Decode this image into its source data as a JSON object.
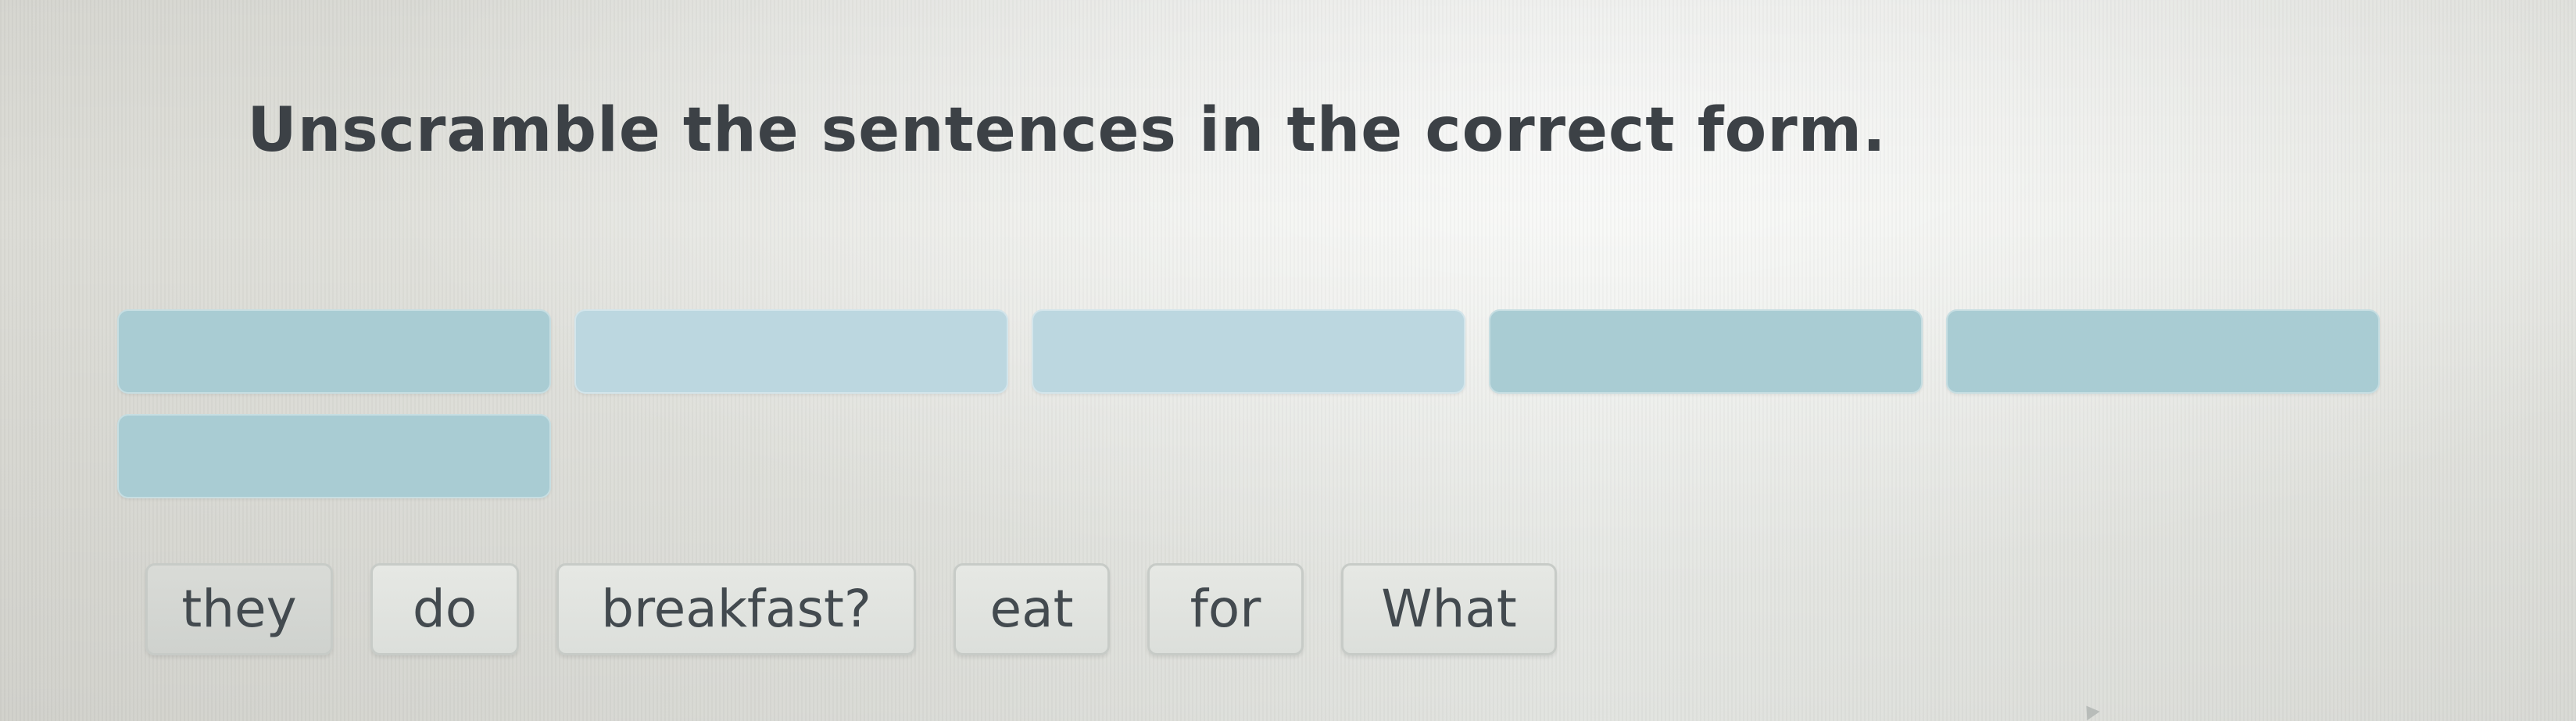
{
  "exercise": {
    "title": "Unscramble the sentences in the correct form."
  },
  "answer_slots": [
    {
      "state": "empty"
    },
    {
      "state": "empty"
    },
    {
      "state": "empty"
    },
    {
      "state": "empty"
    },
    {
      "state": "empty"
    },
    {
      "state": "empty"
    }
  ],
  "word_bank": {
    "words": [
      "they",
      "do",
      "breakfast?",
      "eat",
      "for",
      "What"
    ]
  },
  "colors": {
    "slot_fill": "#a9ccd3",
    "tile_fill": "#e6e8e4",
    "title_text": "#3c4146"
  }
}
